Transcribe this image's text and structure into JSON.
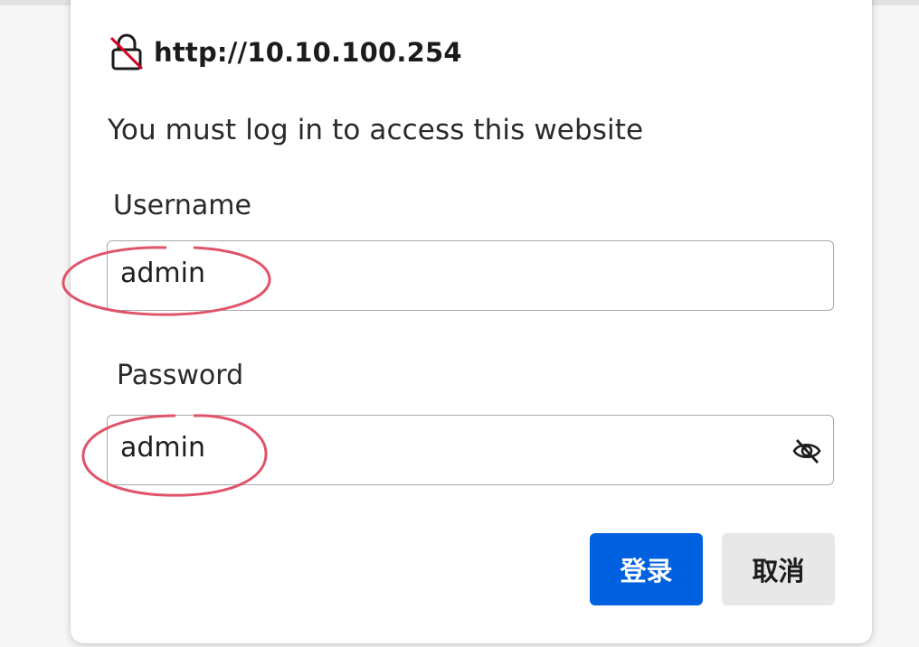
{
  "dialog": {
    "origin": "http://10.10.100.254",
    "origin_icon": "insecure-lock-icon",
    "message": "You must log in to access this website",
    "username": {
      "label": "Username",
      "value": "admin"
    },
    "password": {
      "label": "Password",
      "value": "admin",
      "toggle_icon": "eye-slash-icon"
    },
    "buttons": {
      "login_label": "登录",
      "cancel_label": "取消"
    }
  },
  "colors": {
    "primary": "#0061e0",
    "secondary": "#e8e8e8",
    "annotation": "#e0546a"
  }
}
